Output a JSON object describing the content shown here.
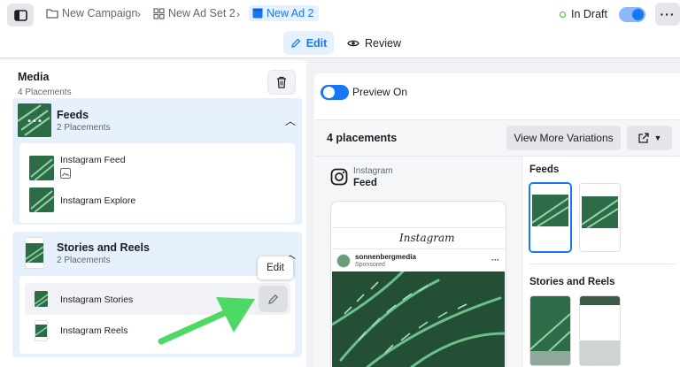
{
  "breadcrumbs": [
    {
      "label": "New Campaign",
      "icon": "folder-icon"
    },
    {
      "label": "New Ad Set 2",
      "icon": "grid-icon"
    },
    {
      "label": "New Ad 2",
      "icon": "ad-icon"
    }
  ],
  "status": {
    "label": "In Draft",
    "color": "#42b72a"
  },
  "modes": {
    "edit": "Edit",
    "review": "Review"
  },
  "media": {
    "title": "Media",
    "subtitle": "4 Placements",
    "groups": [
      {
        "title": "Feeds",
        "subtitle": "2 Placements",
        "items": [
          {
            "label": "Instagram Feed"
          },
          {
            "label": "Instagram Explore"
          }
        ]
      },
      {
        "title": "Stories and Reels",
        "subtitle": "2 Placements",
        "items": [
          {
            "label": "Instagram Stories"
          },
          {
            "label": "Instagram Reels"
          }
        ]
      }
    ],
    "tooltip": "Edit"
  },
  "preview": {
    "toggle_label": "Preview On",
    "placements_title": "4 placements",
    "variations_button": "View More Variations",
    "platform": "Instagram",
    "placement": "Feed",
    "wordmark": "Instagram",
    "account": "sonnenbergmedia",
    "sponsored": "Sponsored",
    "sections": {
      "feeds": "Feeds",
      "stories": "Stories and Reels"
    }
  },
  "colors": {
    "accent": "#1877f2",
    "arrow": "#4cd964",
    "leaf": "#2e7d4f"
  }
}
